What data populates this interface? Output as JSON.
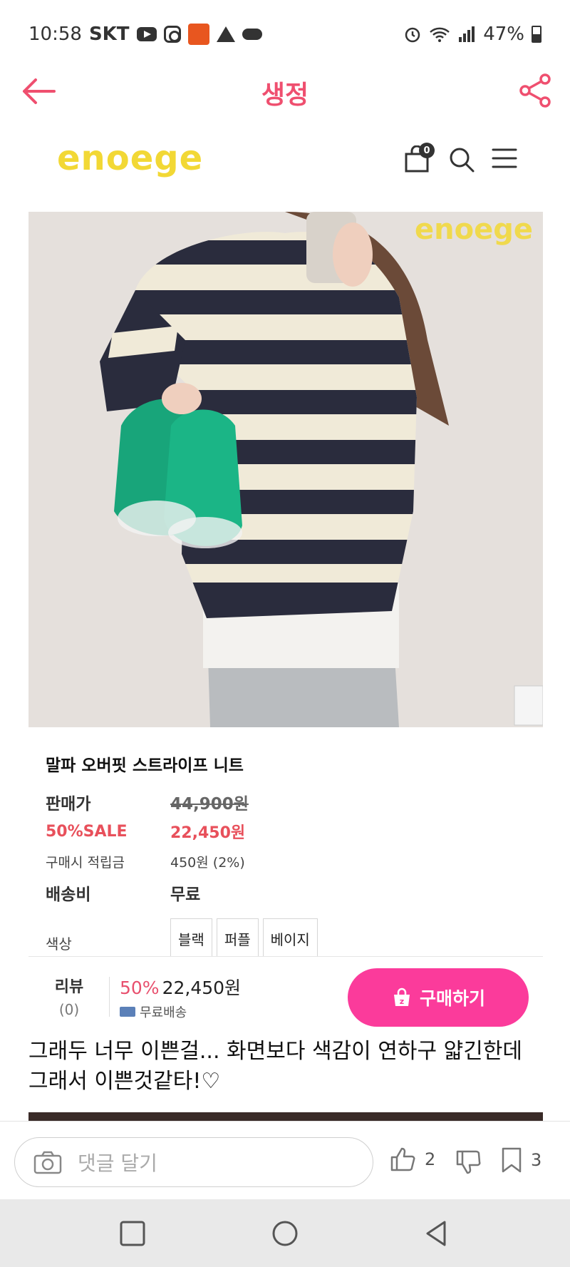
{
  "status_bar": {
    "time": "10:58",
    "carrier": "SKT",
    "battery": "47%"
  },
  "header": {
    "title": "생정"
  },
  "shop": {
    "logo": "enoege",
    "cart_count": "0"
  },
  "product": {
    "watermark": "enoege",
    "name": "말파 오버핏 스트라이프 니트",
    "price_label": "판매가",
    "original_price": "44,900원",
    "sale_label": "50%SALE",
    "sale_price": "22,450원",
    "points_label": "구매시 적립금",
    "points_value": "450원 (2%)",
    "shipping_label": "배송비",
    "shipping_value": "무료",
    "color_label": "색상",
    "color_options": [
      "블랙",
      "퍼플",
      "베이지"
    ]
  },
  "purchase_bar": {
    "review_label": "리뷰",
    "review_count": "(0)",
    "discount": "50%",
    "price": "22,450원",
    "shipping": "무료배송",
    "buy_label": "구매하기"
  },
  "comment": {
    "text": "그래두 너무 이쁜걸... 화면보다 색감이 연하구 얇긴한데 그래서 이쁜것같타!♡"
  },
  "comment_bar": {
    "placeholder": "댓글 달기",
    "like_count": "2",
    "bookmark_count": "3"
  },
  "colors": {
    "accent_pink": "#fb3b9b",
    "title_red": "#ef4f6f",
    "logo_yellow": "#f2d835"
  }
}
